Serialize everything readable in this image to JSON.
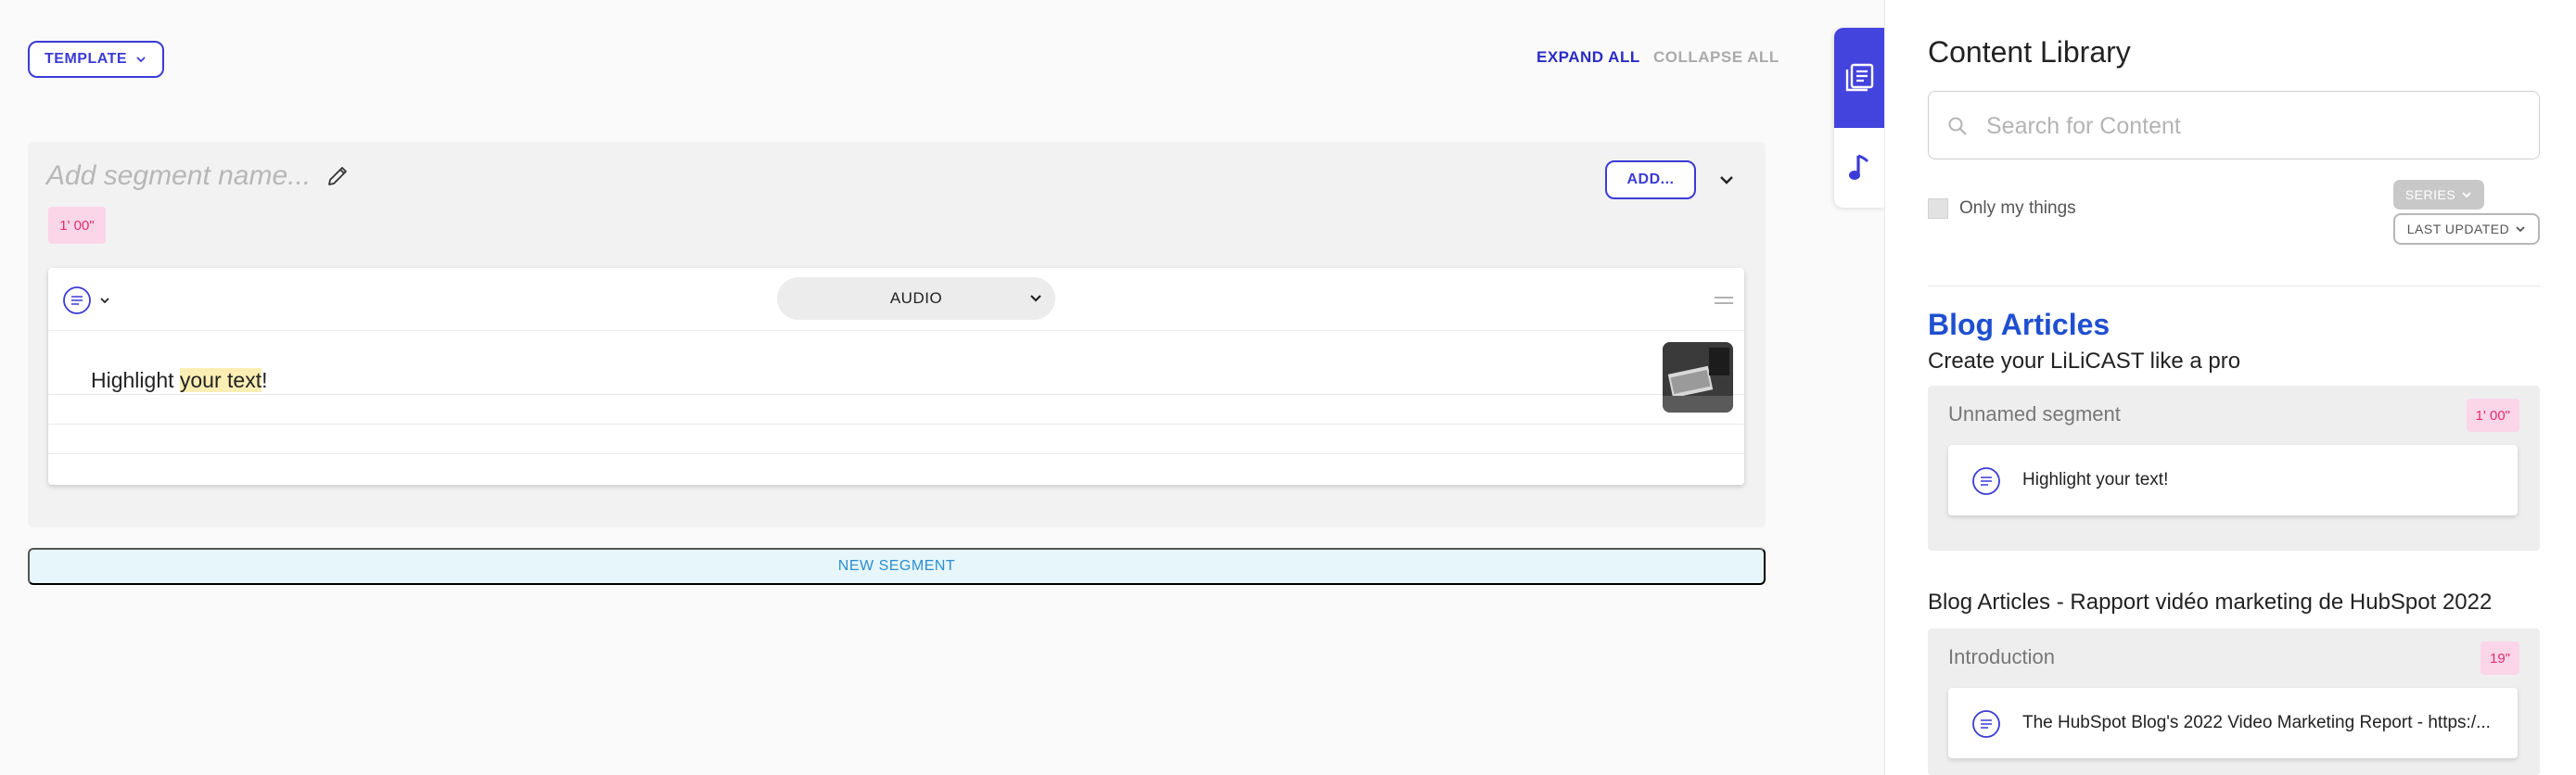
{
  "toolbar": {
    "template_label": "TEMPLATE",
    "expand_all_label": "EXPAND ALL",
    "collapse_all_label": "COLLAPSE ALL"
  },
  "segment": {
    "name_placeholder": "Add segment name...",
    "duration": "1' 00\"",
    "add_label": "ADD...",
    "card": {
      "type_select": "AUDIO",
      "text_before": "Highlight ",
      "text_highlight": "your text",
      "text_after": "!"
    }
  },
  "new_segment_label": "NEW SEGMENT",
  "sidebar_tabs": [
    {
      "icon": "library-icon",
      "active": true
    },
    {
      "icon": "music-note-icon",
      "active": false
    }
  ],
  "library": {
    "title": "Content Library",
    "search_placeholder": "Search for Content",
    "only_my_things_label": "Only my things",
    "series_label": "SERIES",
    "sort_label": "LAST UPDATED",
    "category_title": "Blog Articles",
    "groups": [
      {
        "title": "Create your LiLiCAST like a pro",
        "segment_name": "Unnamed segment",
        "duration": "1' 00\"",
        "card_text": "Highlight your text!"
      },
      {
        "title": "Blog Articles - Rapport vidéo marketing de HubSpot 2022",
        "segment_name": "Introduction",
        "duration": "19\"",
        "card_text": "The HubSpot Blog's 2022 Video Marketing Report - https:/..."
      }
    ]
  },
  "colors": {
    "accent": "#3b3bd6",
    "tab_active": "#4343dd",
    "category": "#1f4fd1",
    "duration_bg": "#fbd5e8",
    "duration_text": "#e0306f",
    "highlight": "#fbeeb4",
    "new_segment_bg": "#e6f6fb"
  }
}
